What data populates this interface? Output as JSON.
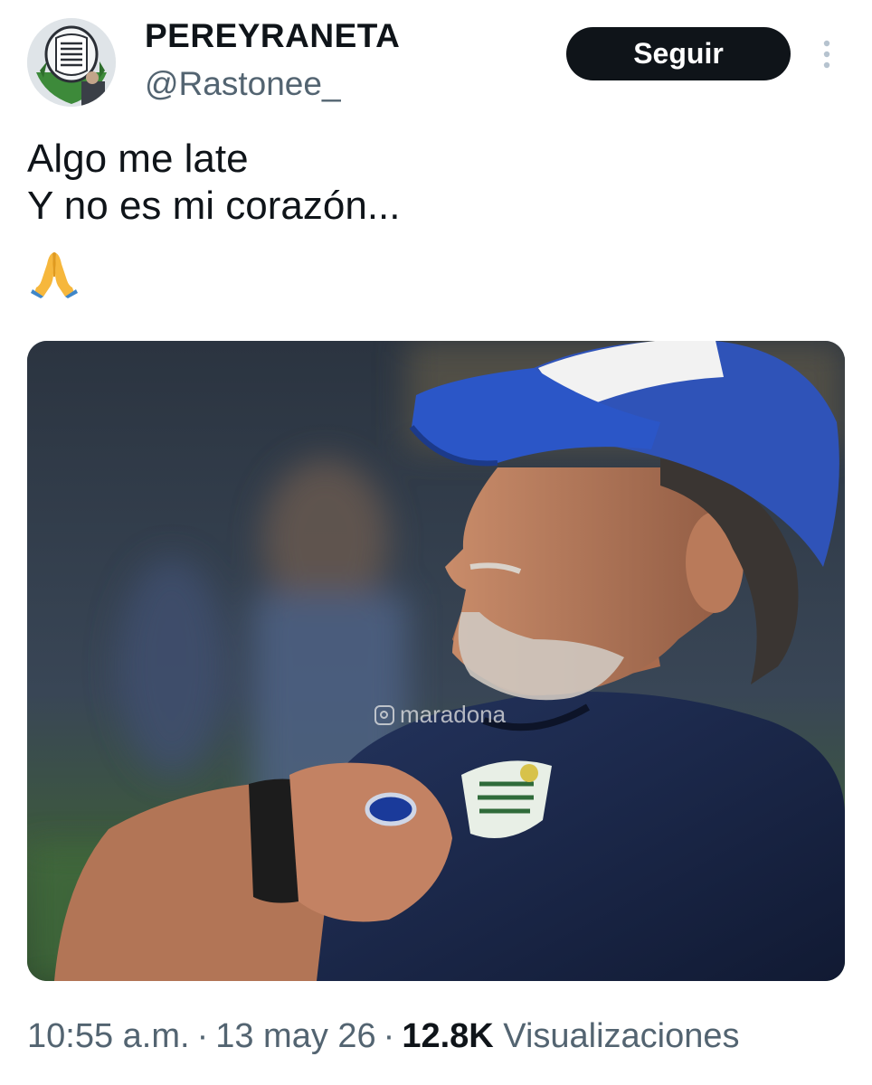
{
  "author": {
    "display_name": "PEREYRANETA",
    "handle": "@Rastonee_",
    "avatar_icon": "club-crest-avatar"
  },
  "actions": {
    "follow_label": "Seguir",
    "more_icon": "vertical-ellipsis-icon"
  },
  "tweet": {
    "lines": [
      "Algo me late",
      "Y no es mi corazón..."
    ],
    "emoji": "🙏"
  },
  "media": {
    "watermark": "maradona"
  },
  "meta": {
    "time": "10:55 a.m.",
    "separator": "·",
    "date": "13 may 26",
    "views_count": "12.8K",
    "views_label": "Visualizaciones"
  },
  "colors": {
    "text_primary": "#0f1419",
    "text_secondary": "#536471",
    "button_bg": "#0f1419",
    "button_text": "#ffffff"
  }
}
